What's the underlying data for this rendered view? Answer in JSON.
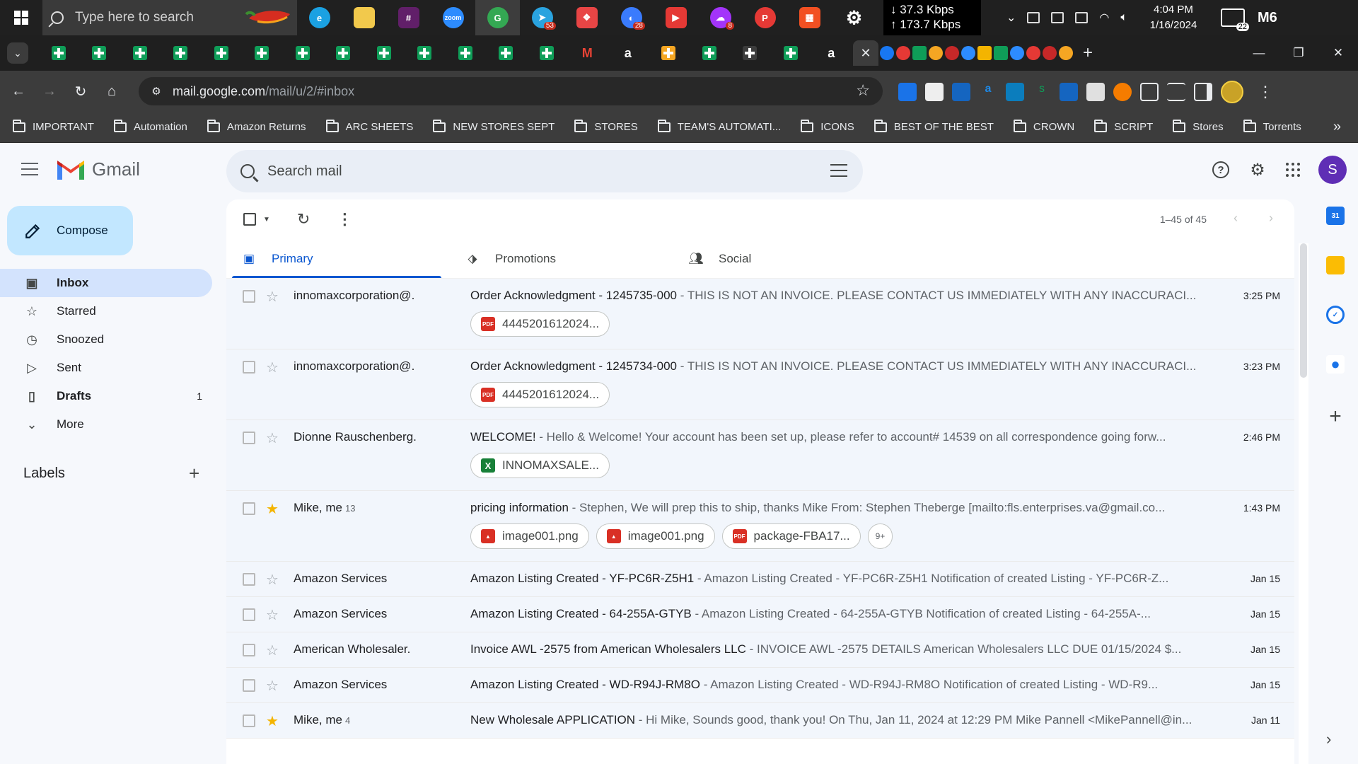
{
  "taskbar": {
    "search_placeholder": "Type here to search",
    "net_down": "↓ 37.3 Kbps",
    "net_up": "↑ 173.7 Kbps",
    "time": "4:04 PM",
    "date": "1/16/2024",
    "notification_count": "22",
    "tray_label": "M6",
    "apps": [
      {
        "name": "edge-icon",
        "color": "#1ba1e2",
        "label": "e",
        "badge": ""
      },
      {
        "name": "file-explorer-icon",
        "color": "#f2c94c",
        "label": "",
        "badge": ""
      },
      {
        "name": "slack-icon",
        "color": "#611f69",
        "label": "#",
        "badge": ""
      },
      {
        "name": "zoom-icon",
        "color": "#2d8cff",
        "label": "zoom",
        "badge": ""
      },
      {
        "name": "chrome-icon",
        "color": "#34a853",
        "label": "G",
        "badge": ""
      },
      {
        "name": "telegram-icon",
        "color": "#2aa3df",
        "label": "➤",
        "badge": "53"
      },
      {
        "name": "photos-icon",
        "color": "#e84545",
        "label": "❖",
        "badge": ""
      },
      {
        "name": "messenger-app-icon",
        "color": "#3a7bfd",
        "label": "◐",
        "badge": "28"
      },
      {
        "name": "kodak-icon",
        "color": "#e53935",
        "label": "▶",
        "badge": ""
      },
      {
        "name": "messenger-icon",
        "color": "#a334fa",
        "label": "☁",
        "badge": "8"
      },
      {
        "name": "psiphon-icon",
        "color": "#e53935",
        "label": "P",
        "badge": ""
      },
      {
        "name": "store-icon",
        "color": "#f25022",
        "label": "▦",
        "badge": ""
      },
      {
        "name": "settings-icon",
        "color": "#202020",
        "label": "⚙",
        "badge": ""
      }
    ]
  },
  "browser": {
    "url_host": "mail.google.com",
    "url_path": "/mail/u/2/#inbox",
    "bookmarks": [
      "IMPORTANT",
      "Automation",
      "Amazon Returns",
      "ARC SHEETS",
      "NEW STORES SEPT",
      "STORES",
      "TEAM'S AUTOMATI...",
      "ICONS",
      "BEST OF THE BEST",
      "CROWN",
      "SCRIPT",
      "Stores",
      "Torrents"
    ]
  },
  "gmail": {
    "logo_text": "Gmail",
    "search_placeholder": "Search mail",
    "avatar_letter": "S",
    "compose_label": "Compose",
    "nav": [
      {
        "label": "Inbox",
        "count": "",
        "icon": "inbox-icon",
        "glyph": "▣",
        "active": true
      },
      {
        "label": "Starred",
        "count": "",
        "icon": "star-icon",
        "glyph": "☆",
        "active": false
      },
      {
        "label": "Snoozed",
        "count": "",
        "icon": "clock-icon",
        "glyph": "◷",
        "active": false
      },
      {
        "label": "Sent",
        "count": "",
        "icon": "send-icon",
        "glyph": "▷",
        "active": false
      },
      {
        "label": "Drafts",
        "count": "1",
        "icon": "draft-icon",
        "glyph": "▯",
        "active": false
      },
      {
        "label": "More",
        "count": "",
        "icon": "chevron-down-icon",
        "glyph": "⌄",
        "active": false
      }
    ],
    "labels_title": "Labels",
    "pager": "1–45 of 45",
    "tabs": [
      {
        "label": "Primary",
        "icon": "inbox-tab-icon"
      },
      {
        "label": "Promotions",
        "icon": "tag-icon"
      },
      {
        "label": "Social",
        "icon": "people-icon"
      }
    ],
    "emails": [
      {
        "sender": "innomaxcorporation@.",
        "count": "",
        "starred": false,
        "subject": "Order Acknowledgment - 1245735-000",
        "snippet": " - THIS IS NOT AN INVOICE. PLEASE CONTACT US IMMEDIATELY WITH ANY INACCURACI...",
        "time": "3:25 PM",
        "attachments": [
          {
            "name": "4445201612024...",
            "type": "pdf"
          }
        ],
        "more": ""
      },
      {
        "sender": "innomaxcorporation@.",
        "count": "",
        "starred": false,
        "subject": "Order Acknowledgment - 1245734-000",
        "snippet": " - THIS IS NOT AN INVOICE. PLEASE CONTACT US IMMEDIATELY WITH ANY INACCURACI...",
        "time": "3:23 PM",
        "attachments": [
          {
            "name": "4445201612024...",
            "type": "pdf"
          }
        ],
        "more": ""
      },
      {
        "sender": "Dionne Rauschenberg.",
        "count": "",
        "starred": false,
        "subject": "WELCOME!",
        "snippet": " - Hello & Welcome! Your account has been set up, please refer to account# 14539 on all correspondence going forw...",
        "time": "2:46 PM",
        "attachments": [
          {
            "name": "INNOMAXSALE...",
            "type": "xls"
          }
        ],
        "more": ""
      },
      {
        "sender": "Mike, me",
        "count": "13",
        "starred": true,
        "subject": "pricing information",
        "snippet": " - Stephen, We will prep this to ship, thanks Mike From: Stephen Theberge [mailto:fls.enterprises.va@gmail.co...",
        "time": "1:43 PM",
        "attachments": [
          {
            "name": "image001.png",
            "type": "img"
          },
          {
            "name": "image001.png",
            "type": "img"
          },
          {
            "name": "package-FBA17...",
            "type": "pdf"
          }
        ],
        "more": "9+"
      },
      {
        "sender": "Amazon Services",
        "count": "",
        "starred": false,
        "subject": "Amazon Listing Created - YF-PC6R-Z5H1",
        "snippet": " - Amazon Listing Created - YF-PC6R-Z5H1 Notification of created Listing - YF-PC6R-Z...",
        "time": "Jan 15",
        "attachments": [],
        "more": ""
      },
      {
        "sender": "Amazon Services",
        "count": "",
        "starred": false,
        "subject": "Amazon Listing Created - 64-255A-GTYB",
        "snippet": " - Amazon Listing Created - 64-255A-GTYB Notification of created Listing - 64-255A-...",
        "time": "Jan 15",
        "attachments": [],
        "more": ""
      },
      {
        "sender": "American Wholesaler.",
        "count": "",
        "starred": false,
        "subject": "Invoice AWL -2575 from American Wholesalers LLC",
        "snippet": " - INVOICE AWL -2575 DETAILS American Wholesalers LLC DUE 01/15/2024 $...",
        "time": "Jan 15",
        "attachments": [],
        "more": ""
      },
      {
        "sender": "Amazon Services",
        "count": "",
        "starred": false,
        "subject": "Amazon Listing Created - WD-R94J-RM8O",
        "snippet": " - Amazon Listing Created - WD-R94J-RM8O Notification of created Listing - WD-R9...",
        "time": "Jan 15",
        "attachments": [],
        "more": ""
      },
      {
        "sender": "Mike, me",
        "count": "4",
        "starred": true,
        "subject": "New Wholesale APPLICATION",
        "snippet": " - Hi Mike, Sounds good, thank you! On Thu, Jan 11, 2024 at 12:29 PM Mike Pannell <MikePannell@in...",
        "time": "Jan 11",
        "attachments": [],
        "more": ""
      }
    ]
  },
  "colors": {
    "accent": "#0b57d0",
    "compose_bg": "#c2e7ff",
    "active_nav": "#d3e3fd",
    "star": "#f4b400"
  }
}
